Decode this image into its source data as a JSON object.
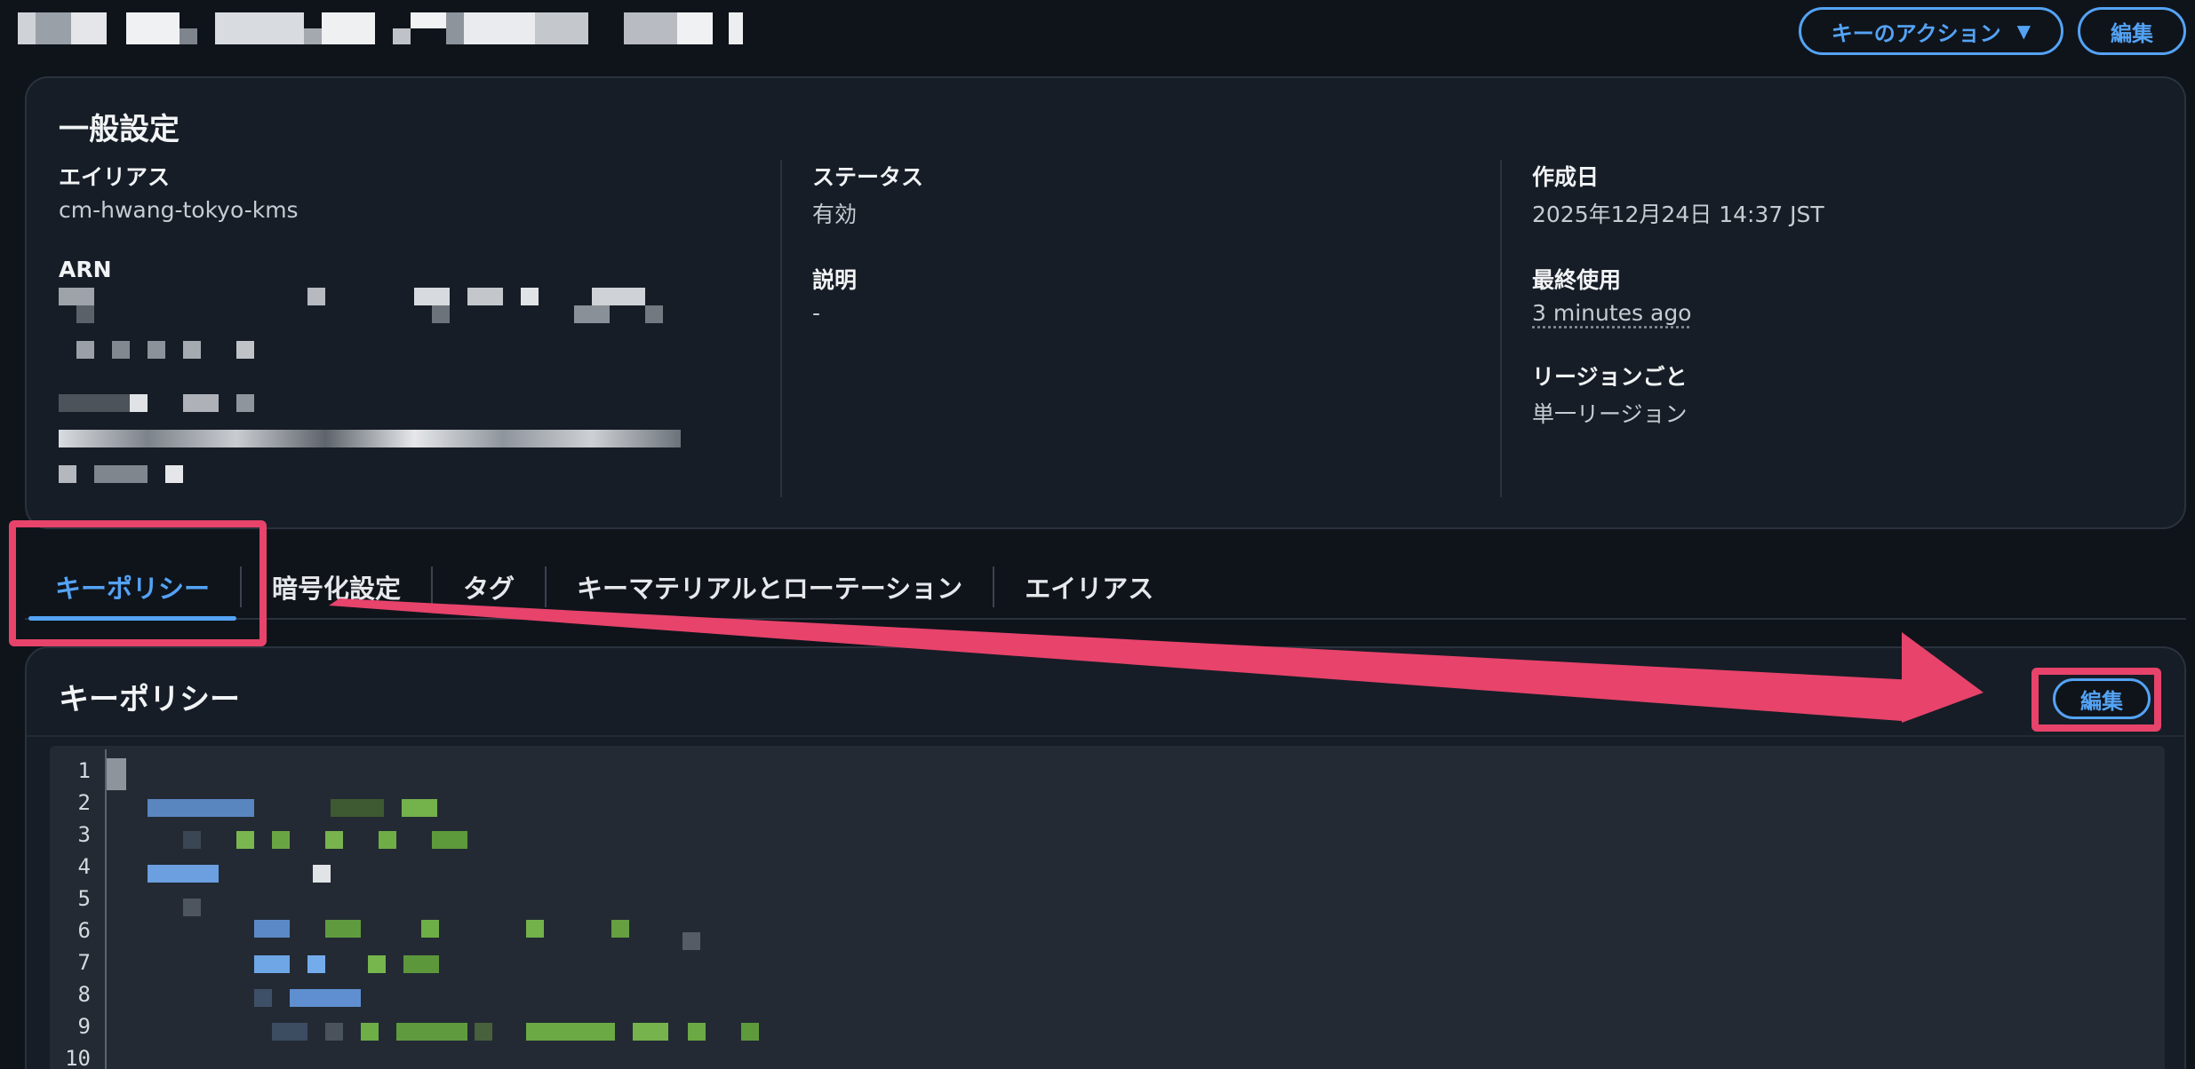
{
  "header": {
    "key_actions_label": "キーのアクション",
    "edit_label": "編集"
  },
  "general": {
    "title": "一般設定",
    "alias_label": "エイリアス",
    "alias_value": "cm-hwang-tokyo-kms",
    "arn_label": "ARN",
    "status_label": "ステータス",
    "status_value": "有効",
    "description_label": "説明",
    "description_value": "-",
    "created_label": "作成日",
    "created_value": "2025年12月24日 14:37 JST",
    "last_used_label": "最終使用",
    "last_used_value": "3 minutes ago",
    "region_label": "リージョンごと",
    "region_value": "単一リージョン"
  },
  "tabs": [
    {
      "label": "キーポリシー"
    },
    {
      "label": "暗号化設定"
    },
    {
      "label": "タグ"
    },
    {
      "label": "キーマテリアルとローテーション"
    },
    {
      "label": "エイリアス"
    }
  ],
  "policy": {
    "title": "キーポリシー",
    "edit_label": "編集",
    "line_numbers": [
      "1",
      "2",
      "3",
      "4",
      "5",
      "6",
      "7",
      "8",
      "9",
      "10"
    ]
  },
  "colors": {
    "accent": "#54a3f5",
    "annotation": "#e7436b",
    "panel_bg": "#161d26",
    "page_bg": "#0f141b"
  }
}
